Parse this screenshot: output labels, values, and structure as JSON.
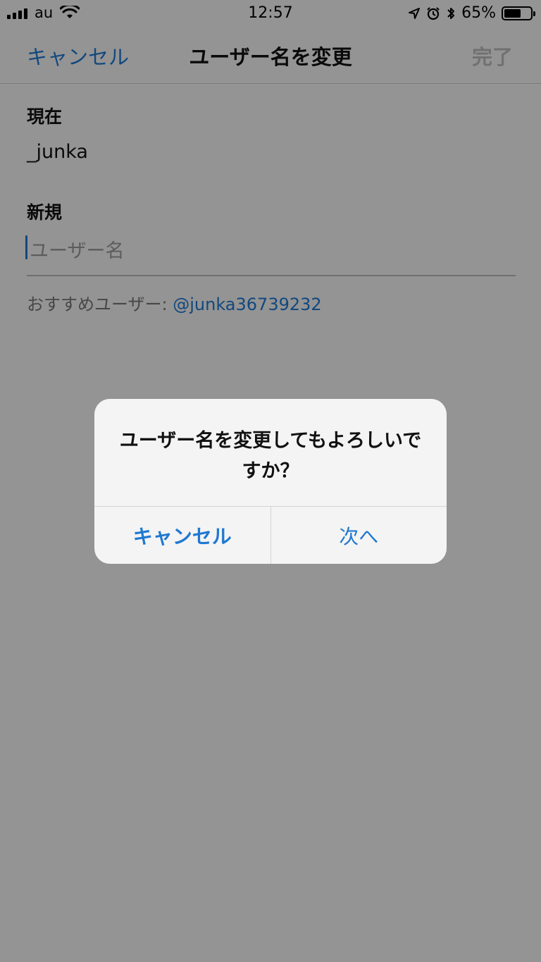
{
  "status_bar": {
    "carrier": "au",
    "time": "12:57",
    "battery_text": "65%",
    "battery_level": 0.65
  },
  "nav": {
    "cancel_label": "キャンセル",
    "title": "ユーザー名を変更",
    "done_label": "完了"
  },
  "form": {
    "current_label": "現在",
    "current_value": "_junka",
    "new_label": "新規",
    "new_placeholder": "ユーザー名",
    "new_value": "",
    "suggestion_prefix": "おすすめユーザー: ",
    "suggestion_handle": "@junka36739232"
  },
  "alert": {
    "title": "ユーザー名を変更してもよろしいですか？",
    "cancel_label": "キャンセル",
    "next_label": "次へ"
  },
  "colors": {
    "accent": "#1f78d1",
    "disabled": "#bdbdbd"
  }
}
